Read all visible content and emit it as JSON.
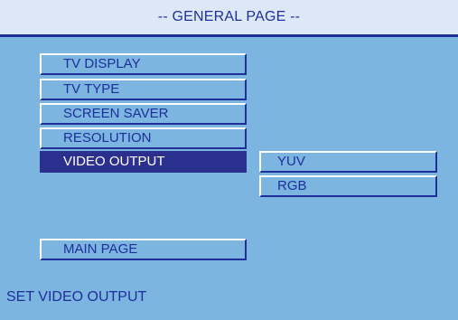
{
  "header": {
    "title": "-- GENERAL PAGE --"
  },
  "menu": {
    "items": [
      {
        "label": "TV DISPLAY"
      },
      {
        "label": "TV TYPE"
      },
      {
        "label": "SCREEN SAVER"
      },
      {
        "label": "RESOLUTION"
      },
      {
        "label": "VIDEO OUTPUT",
        "selected": true
      }
    ],
    "main_page_label": "MAIN PAGE"
  },
  "submenu": {
    "options": [
      {
        "label": "YUV"
      },
      {
        "label": "RGB"
      }
    ]
  },
  "status": {
    "text": "SET VIDEO OUTPUT"
  },
  "colors": {
    "panel": "#7bb5e0",
    "header": "#dde8f7",
    "text": "#1f2f9a",
    "selected": "#2b2f8e"
  }
}
